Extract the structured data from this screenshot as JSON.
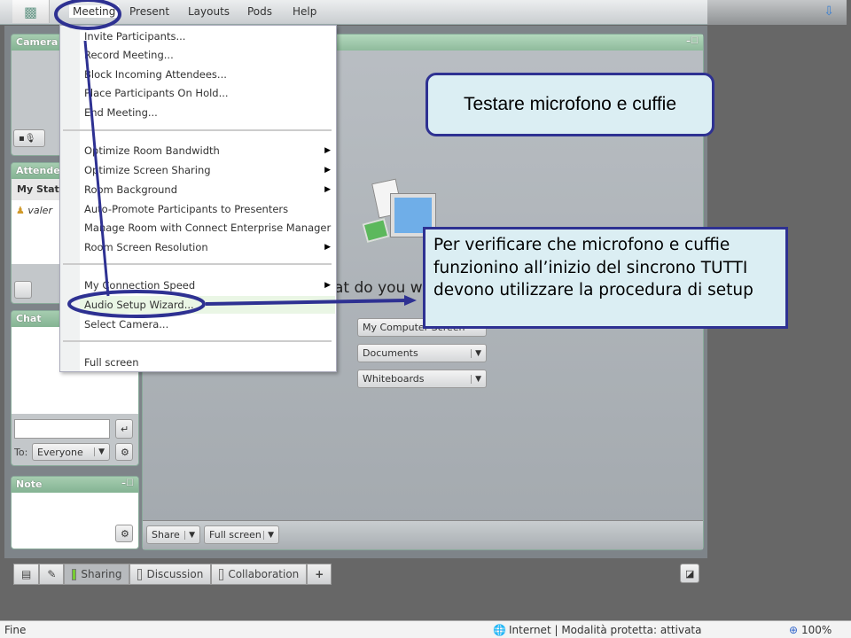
{
  "menubar": {
    "items": [
      "Meeting",
      "Present",
      "Layouts",
      "Pods",
      "Help"
    ]
  },
  "meeting_menu": {
    "group1": [
      "Invite Participants...",
      "Record Meeting...",
      "Block Incoming Attendees...",
      "Place Participants On Hold...",
      "End Meeting..."
    ],
    "group2": [
      {
        "label": "Optimize Room Bandwidth",
        "submenu": true
      },
      {
        "label": "Optimize Screen Sharing",
        "submenu": true
      },
      {
        "label": "Room Background",
        "submenu": true
      },
      {
        "label": "Auto-Promote Participants to Presenters",
        "submenu": false
      },
      {
        "label": "Manage Room with Connect Enterprise Manager",
        "submenu": false
      },
      {
        "label": "Room Screen Resolution",
        "submenu": true
      }
    ],
    "group3": [
      {
        "label": "My Connection Speed",
        "submenu": true
      },
      {
        "label": "Audio Setup Wizard...",
        "submenu": false,
        "highlighted": true
      },
      {
        "label": "Select Camera...",
        "submenu": false
      }
    ],
    "group4": [
      "Full screen"
    ]
  },
  "pods": {
    "camera": {
      "title": "Camera a"
    },
    "attendees": {
      "title": "Attende",
      "my_status": "My Statu",
      "attendee": "valer"
    },
    "chat": {
      "title": "Chat",
      "to_label": "To:",
      "to_value": "Everyone"
    },
    "note": {
      "title": "Note"
    }
  },
  "share_pod": {
    "prompt": "at do you w",
    "options": [
      "My Computer Screen",
      "Documents",
      "Whiteboards"
    ],
    "share_btn": "Share",
    "fullscreen_btn": "Full screen"
  },
  "bottom_tabs": [
    "Sharing",
    "Discussion",
    "Collaboration"
  ],
  "callouts": {
    "title": "Testare  microfono e cuffie",
    "body": "Per verificare che microfono e cuffie funzionino all’inizio del sincrono TUTTI devono utilizzare la procedura di setup"
  },
  "statusbar": {
    "left": "Fine",
    "zone": "Internet | Modalità protetta: attivata",
    "zoom": "100%"
  },
  "colors": {
    "annotation": "#2e3192",
    "callout_bg": "#dbeef3",
    "pod_header": "#8fbb9c"
  }
}
